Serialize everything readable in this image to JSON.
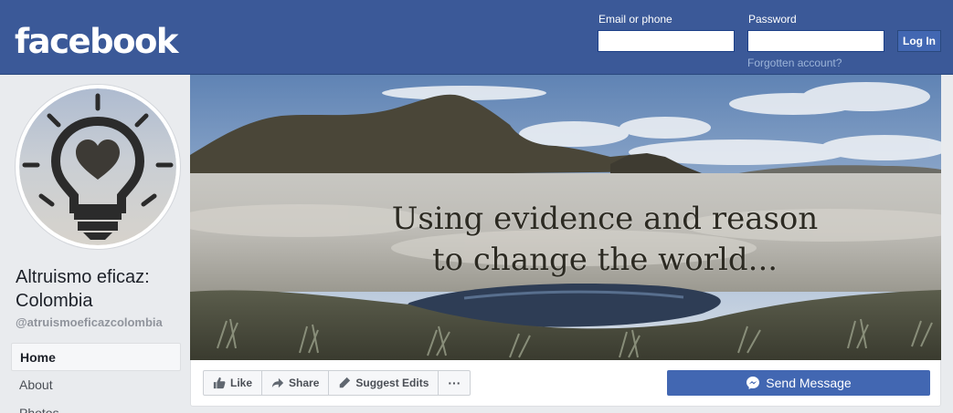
{
  "header": {
    "logo": "facebook",
    "email_label": "Email or phone",
    "password_label": "Password",
    "login_button": "Log In",
    "forgot_link": "Forgotten account?"
  },
  "page": {
    "name": "Altruismo eficaz: Colombia",
    "handle": "@atruismoeficazcolombia"
  },
  "sidebar": {
    "items": [
      {
        "label": "Home",
        "active": true
      },
      {
        "label": "About",
        "active": false
      },
      {
        "label": "Photos",
        "active": false
      }
    ]
  },
  "cover": {
    "line1": "Using evidence and reason",
    "line2": "to change the world..."
  },
  "actions": {
    "like": "Like",
    "share": "Share",
    "suggest_edits": "Suggest Edits",
    "more": "···",
    "send_message": "Send Message"
  },
  "colors": {
    "brand": "#3b5998",
    "button": "#4267b2"
  }
}
